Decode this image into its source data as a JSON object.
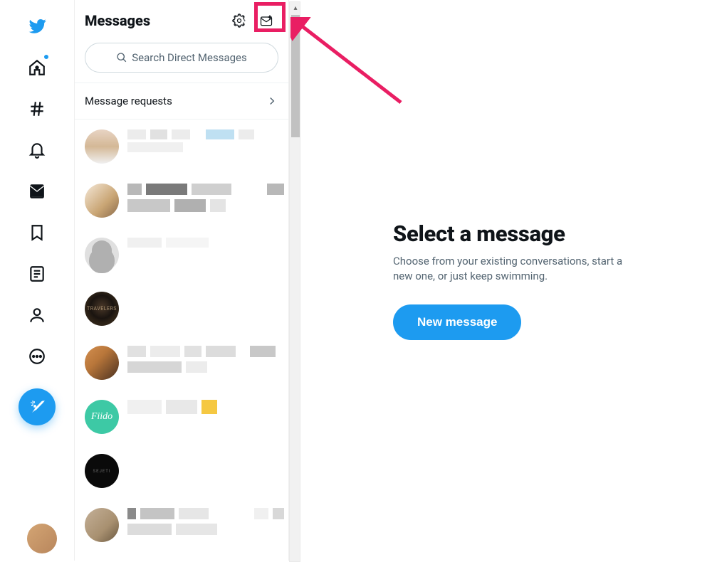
{
  "header": {
    "title": "Messages"
  },
  "search": {
    "placeholder": "Search Direct Messages"
  },
  "requests": {
    "label": "Message requests"
  },
  "main": {
    "title": "Select a message",
    "subtitle": "Choose from your existing conversations, start a new one, or just keep swimming.",
    "button": "New message"
  },
  "avatars": {
    "av4_text": "TRAVELERS",
    "av6_text": "Fiido",
    "av7_text": "SEJETI"
  }
}
